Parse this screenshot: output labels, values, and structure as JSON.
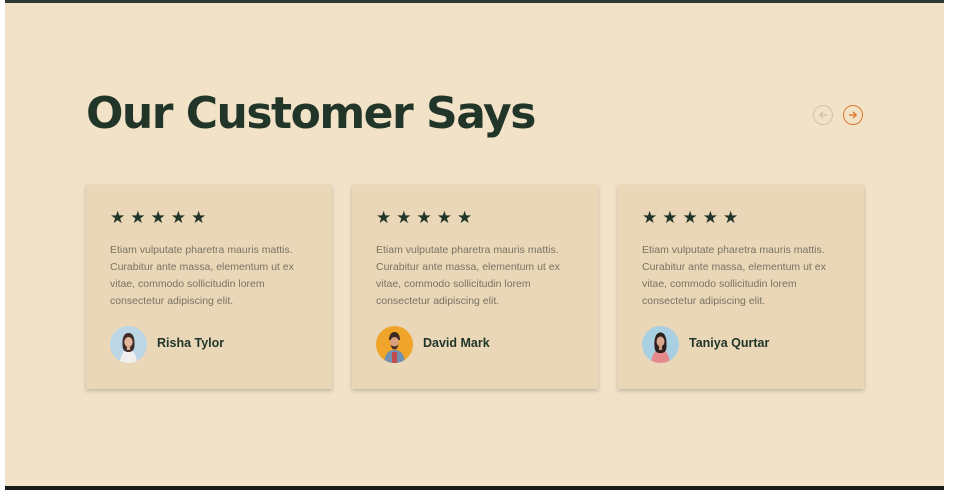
{
  "section": {
    "title": "Our Customer Says"
  },
  "nav": {
    "prev_icon": "arrow-left-circle-icon",
    "next_icon": "arrow-right-circle-icon",
    "prev_color": "#cfc3ad",
    "next_color": "#e07a2e"
  },
  "testimonials": [
    {
      "stars": "★★★★★",
      "rating": 5,
      "text": "Etiam vulputate pharetra mauris mattis. Curabitur ante massa, elementum ut ex vitae, commodo sollicitudin lorem consectetur adipiscing elit.",
      "author": "Risha Tylor"
    },
    {
      "stars": "★★★★★",
      "rating": 5,
      "text": "Etiam vulputate pharetra mauris mattis. Curabitur ante massa, elementum ut ex vitae, commodo sollicitudin lorem consectetur adipiscing elit.",
      "author": "David Mark"
    },
    {
      "stars": "★★★★★",
      "rating": 5,
      "text": "Etiam vulputate pharetra mauris mattis. Curabitur ante massa, elementum ut ex vitae, commodo sollicitudin lorem consectetur adipiscing elit.",
      "author": "Taniya Qurtar"
    }
  ],
  "colors": {
    "background": "#f1e2c8",
    "card": "#e9d7b8",
    "heading": "#223529",
    "body_text": "#7a7260",
    "accent": "#e07a2e"
  }
}
